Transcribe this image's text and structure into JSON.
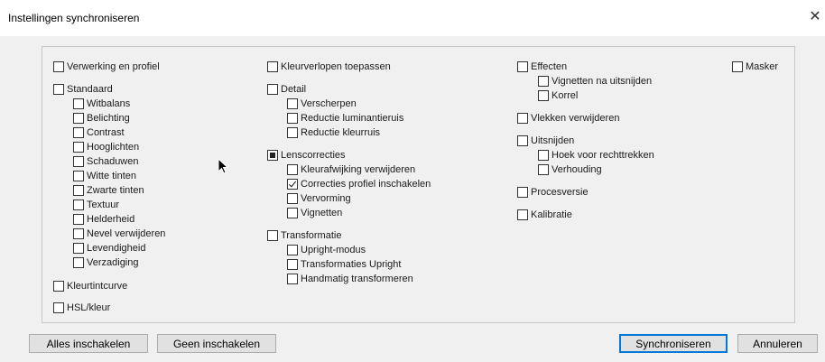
{
  "window": {
    "title": "Instellingen synchroniseren",
    "close_glyph": "✕"
  },
  "checkboxes": {
    "verwerking": "Verwerking en profiel",
    "standaard": "Standaard",
    "witbalans": "Witbalans",
    "belichting": "Belichting",
    "contrast": "Contrast",
    "hooglichten": "Hooglichten",
    "schaduwen": "Schaduwen",
    "witte_tinten": "Witte tinten",
    "zwarte_tinten": "Zwarte tinten",
    "textuur": "Textuur",
    "helderheid": "Helderheid",
    "nevel": "Nevel verwijderen",
    "levendigheid": "Levendigheid",
    "verzadiging": "Verzadiging",
    "kleurtintcurve": "Kleurtintcurve",
    "hsl": "HSL/kleur",
    "kleurverlopen": "Kleurverlopen toepassen",
    "detail": "Detail",
    "verscherpen": "Verscherpen",
    "reductie_lum": "Reductie luminantieruis",
    "reductie_kleur": "Reductie kleurruis",
    "lenscorrecties": "Lenscorrecties",
    "kleurafwijking": "Kleurafwijking verwijderen",
    "correcties_profiel": "Correcties profiel inschakelen",
    "vervorming": "Vervorming",
    "vignetten": "Vignetten",
    "transformatie": "Transformatie",
    "upright_modus": "Upright-modus",
    "transformaties_upright": "Transformaties Upright",
    "handmatig": "Handmatig transformeren",
    "effecten": "Effecten",
    "vignetten_na": "Vignetten na uitsnijden",
    "korrel": "Korrel",
    "vlekken": "Vlekken verwijderen",
    "uitsnijden": "Uitsnijden",
    "hoek": "Hoek voor rechttrekken",
    "verhouding": "Verhouding",
    "procesversie": "Procesversie",
    "kalibratie": "Kalibratie",
    "masker": "Masker"
  },
  "states": {
    "lenscorrecties": "mixed",
    "correcties_profiel": "checked"
  },
  "buttons": {
    "alles": "Alles inschakelen",
    "geen": "Geen inschakelen",
    "synchroniseren": "Synchroniseren",
    "annuleren": "Annuleren"
  }
}
